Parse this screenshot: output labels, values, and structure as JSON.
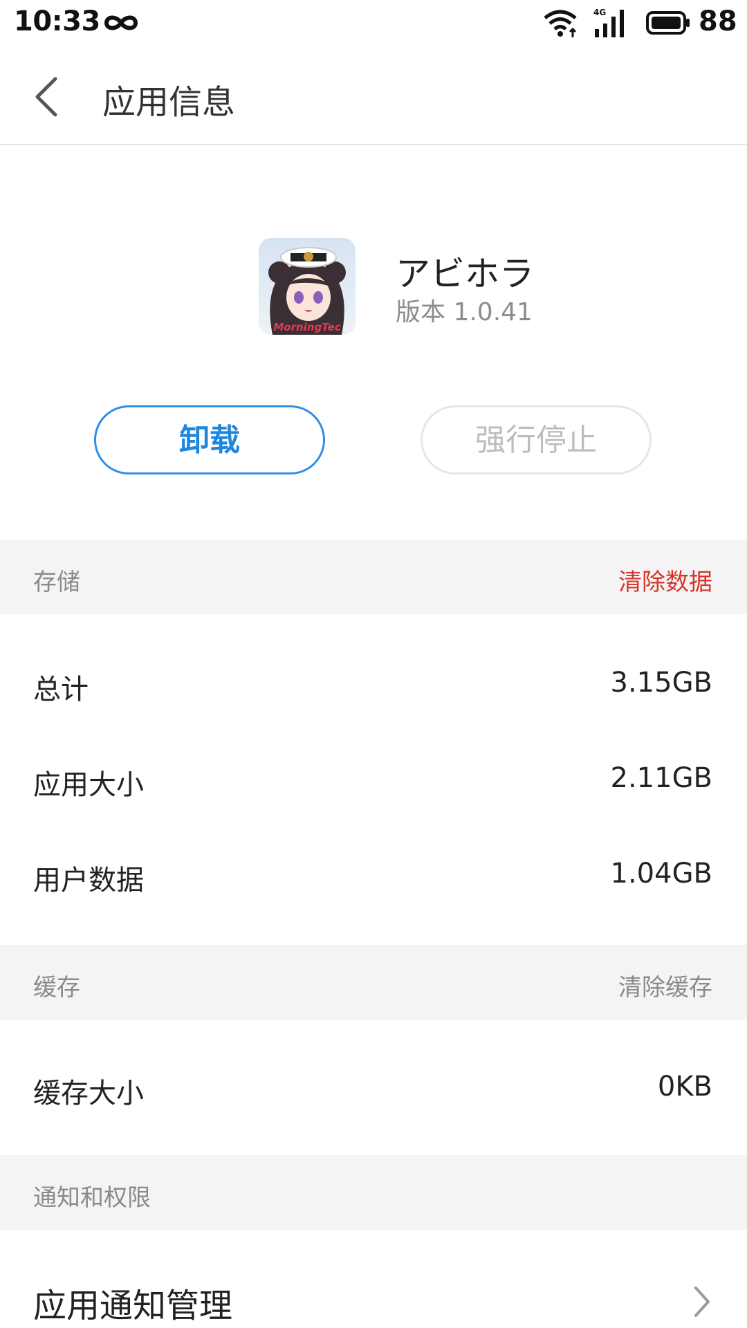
{
  "status_bar": {
    "time": "10:33",
    "battery_percent": "88",
    "network_label": "4G",
    "icons": [
      "infinity-icon",
      "wifi-icon",
      "signal-icon",
      "battery-icon"
    ]
  },
  "header": {
    "title": "应用信息",
    "back_icon": "chevron-left-icon"
  },
  "app": {
    "name": "アビホラ",
    "version": "版本 1.0.41",
    "icon_caption": "MorningTec"
  },
  "actions": {
    "uninstall_label": "卸载",
    "force_stop_label": "强行停止"
  },
  "storage": {
    "section_label": "存储",
    "action_label": "清除数据",
    "rows": [
      {
        "label": "总计",
        "value": "3.15GB"
      },
      {
        "label": "应用大小",
        "value": "2.11GB"
      },
      {
        "label": "用户数据",
        "value": "1.04GB"
      }
    ]
  },
  "cache": {
    "section_label": "缓存",
    "action_label": "清除缓存",
    "rows": [
      {
        "label": "缓存大小",
        "value": "0KB"
      }
    ]
  },
  "permissions": {
    "section_label": "通知和权限",
    "items": [
      {
        "label": "应用通知管理"
      }
    ]
  },
  "colors": {
    "accent_blue": "#1f86e0",
    "danger_red": "#d9342b",
    "section_bg": "#f4f4f4",
    "muted_text": "#8a8a8a"
  }
}
